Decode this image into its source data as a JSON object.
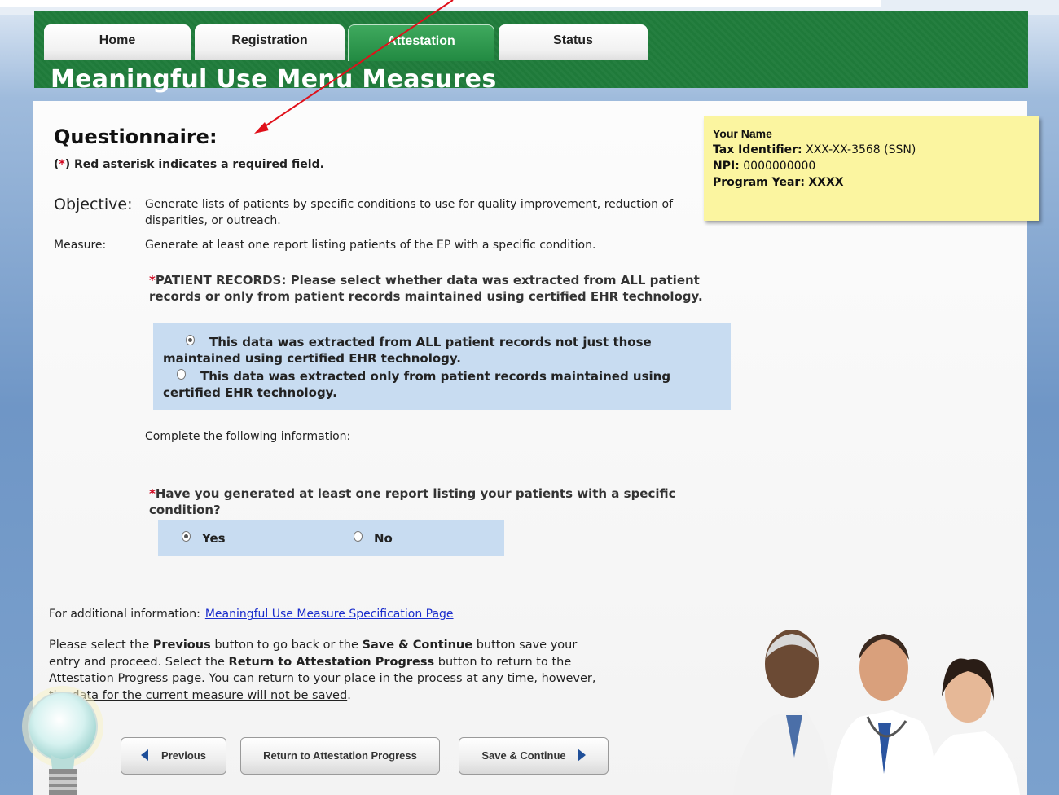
{
  "nav": {
    "tabs": [
      {
        "label": "Home"
      },
      {
        "label": "Registration"
      },
      {
        "label": "Attestation"
      },
      {
        "label": "Status"
      }
    ]
  },
  "page": {
    "title": "Meaningful Use Menu Measures"
  },
  "questionnaire": {
    "heading": "Questionnaire:",
    "required_note_prefix": "(",
    "required_note_asterisk": "*",
    "required_note_suffix": ") Red asterisk indicates a required field.",
    "objective_label": "Objective:",
    "objective_text": "Generate lists of patients by specific conditions to use for quality improvement, reduction of disparities, or outreach.",
    "measure_label": "Measure:",
    "measure_text": "Generate at least one report listing patients of the EP with a specific condition.",
    "patient_records": {
      "asterisk": "*",
      "question": "PATIENT RECORDS: Please select whether data was extracted from ALL patient records or only from patient records maintained using certified EHR technology.",
      "options": [
        {
          "label": "This data was extracted from ALL patient records not just those maintained using certified EHR technology.",
          "selected": true
        },
        {
          "label": "This data was extracted only from patient records maintained using certified EHR technology.",
          "selected": false
        }
      ]
    },
    "complete_text": "Complete the following information:",
    "report_question": {
      "asterisk": "*",
      "question": "Have you generated at least one report listing your patients with a specific condition?",
      "options": [
        {
          "label": "Yes",
          "selected": true
        },
        {
          "label": "No",
          "selected": false
        }
      ]
    }
  },
  "additional_info": {
    "label": "For additional information:",
    "link": "Meaningful Use Measure Specification Page"
  },
  "instructions": {
    "p1": "Please select the ",
    "b1": "Previous",
    "p2": " button to go back or the ",
    "b2": "Save & Continue",
    "p3": " button save your entry and proceed. Select the ",
    "b3": "Return to Attestation Progress",
    "p4": " button to return to the Attestation Progress page. You can return to your place in the process at any time, however, ",
    "u1": "the data for the current measure will not be saved",
    "p5": "."
  },
  "buttons": {
    "previous": "Previous",
    "return": "Return to Attestation Progress",
    "save_continue": "Save & Continue"
  },
  "user_info": {
    "name": "Your Name",
    "tax_label": "Tax Identifier:",
    "tax_value": "XXX-XX-3568 (SSN)",
    "npi_label": "NPI:",
    "npi_value": "0000000000",
    "year_label": "Program Year:",
    "year_value": "XXXX"
  },
  "colors": {
    "header_green": "#1f7a3a",
    "active_tab": "#2e9a50",
    "option_box": "#c8dcf1",
    "note_yellow": "#fbf5a0",
    "asterisk_red": "#d0021b",
    "annotation_arrow": "#e0101a"
  }
}
